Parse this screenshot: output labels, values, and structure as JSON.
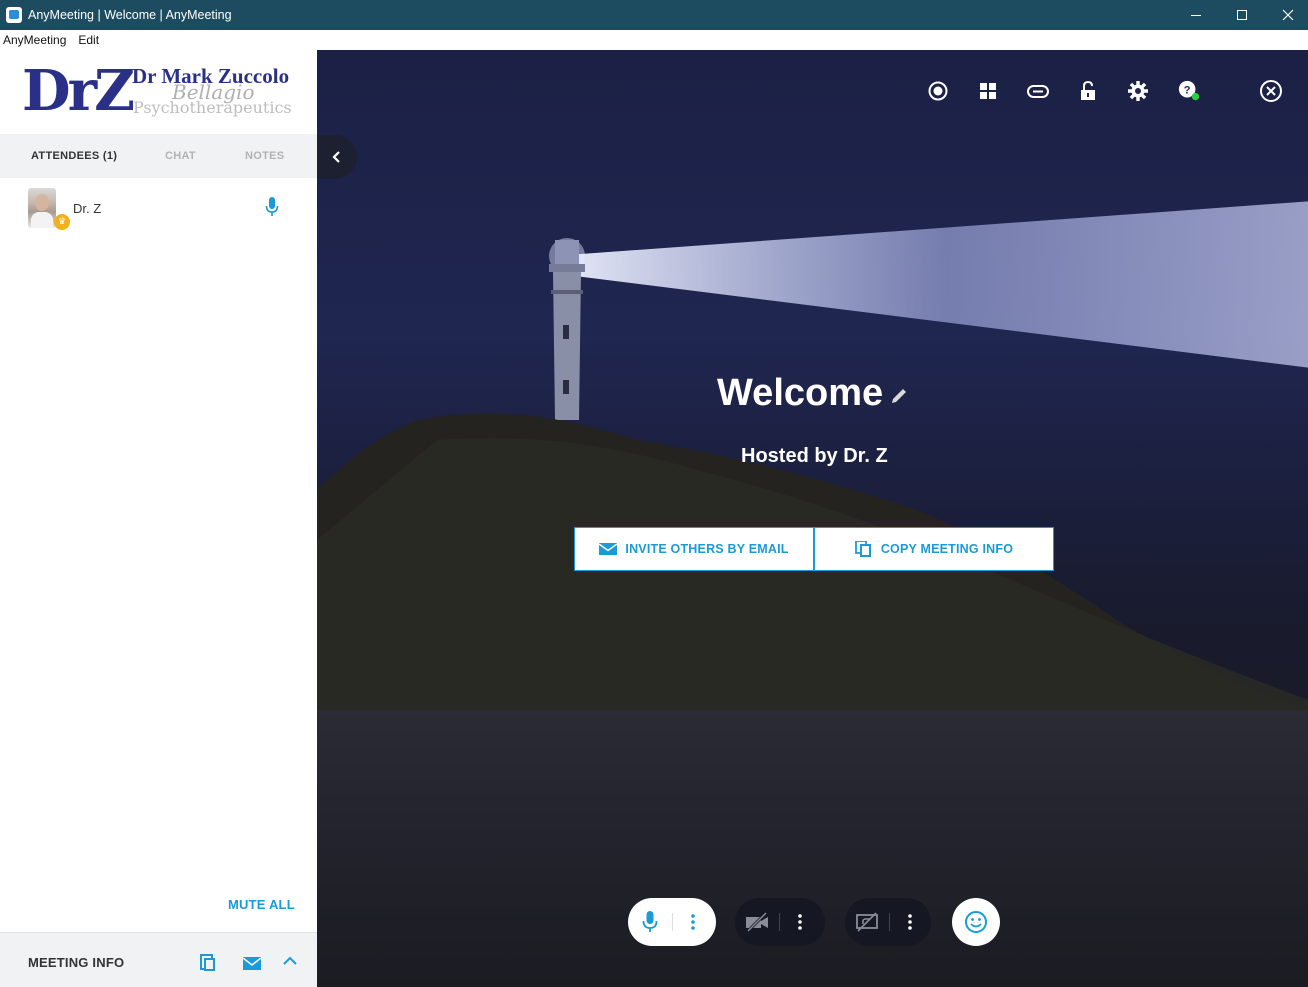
{
  "window": {
    "title": "AnyMeeting | Welcome | AnyMeeting",
    "controls": [
      "minimize",
      "maximize",
      "close"
    ]
  },
  "menubar": {
    "items": [
      "AnyMeeting",
      "Edit"
    ]
  },
  "sidebar": {
    "logo": {
      "initials": "DrZ",
      "name": "Dr Mark Zuccolo",
      "script": "Bellagio",
      "tagline": "Psychotherapeutics"
    },
    "tabs": [
      {
        "label": "ATTENDEES (1)",
        "active": true
      },
      {
        "label": "CHAT",
        "active": false
      },
      {
        "label": "NOTES",
        "active": false
      }
    ],
    "attendees": [
      {
        "name": "Dr. Z",
        "role_icon": "crown-icon",
        "mic": "mic-icon"
      }
    ],
    "mute_all_label": "MUTE ALL",
    "meeting_info": {
      "label": "MEETING INFO",
      "icons": [
        "copy-icon",
        "email-icon",
        "chevron-up-icon"
      ]
    }
  },
  "stage": {
    "title": "Welcome",
    "hosted_by": "Hosted by Dr. Z",
    "invite_button": "INVITE OTHERS BY EMAIL",
    "copy_button": "COPY MEETING INFO",
    "top_icons": [
      "record-icon",
      "layout-grid-icon",
      "gamepad-icon",
      "lock-open-icon",
      "settings-gear-icon",
      "help-icon",
      "close-circle-icon"
    ],
    "status_dot_color": "#2ecc40",
    "accent_color": "#1a9bd7",
    "bottom_controls": [
      "mic-icon",
      "camera-off-icon",
      "screen-share-off-icon",
      "emoji-icon"
    ]
  }
}
